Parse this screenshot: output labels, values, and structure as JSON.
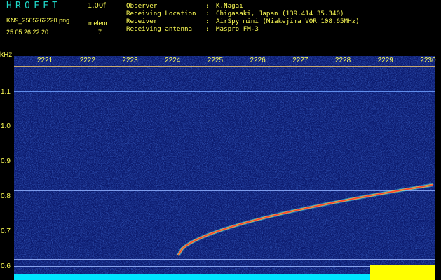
{
  "header": {
    "app_title": "HROFFT",
    "version": "1.00f",
    "filename": "KN9_2505262220.png",
    "datetime": "25.05.26 22:20",
    "mode_label": "meleor",
    "count": "7"
  },
  "info": [
    {
      "key": "Observer",
      "value": "K.Nagai"
    },
    {
      "key": "Receiving Location",
      "value": "Chigasaki, Japan (139.414 35.340)"
    },
    {
      "key": "Receiver",
      "value": "AirSpy mini (Miakejima VOR 108.65MHz)"
    },
    {
      "key": "Receiving antenna",
      "value": "Maspro FM-3"
    }
  ],
  "y_axis": {
    "unit": "kHz",
    "ticks": [
      "1.1",
      "1.0",
      "0.9",
      "0.8",
      "0.7",
      "0.6"
    ]
  },
  "x_axis": {
    "ticks": [
      "2221",
      "2222",
      "2223",
      "2224",
      "2225",
      "2226",
      "2227",
      "2228",
      "2229",
      "2230"
    ]
  },
  "colors": {
    "background": "#000000",
    "spectrogram_bg": "#0b1a6e",
    "text": "#ffff55",
    "title": "#1fd8c8",
    "noise_floor": "#00e5ff",
    "echo": "#ff3b2f"
  }
}
